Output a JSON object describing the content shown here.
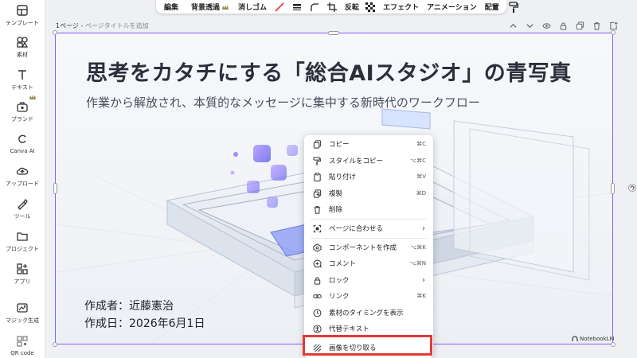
{
  "sidebar": {
    "items": [
      {
        "label": "テンプレート",
        "icon": "template-icon"
      },
      {
        "label": "素材",
        "icon": "elements-icon"
      },
      {
        "label": "テキスト",
        "icon": "text-icon"
      },
      {
        "label": "ブランド",
        "icon": "brand-icon"
      },
      {
        "label": "Canva AI",
        "icon": "canva-ai-icon"
      },
      {
        "label": "アップロード",
        "icon": "upload-icon"
      },
      {
        "label": "ツール",
        "icon": "tools-icon"
      },
      {
        "label": "プロジェクト",
        "icon": "folder-icon"
      },
      {
        "label": "アプリ",
        "icon": "apps-icon"
      },
      {
        "label": "マジック生成",
        "icon": "magic-icon"
      },
      {
        "label": "QR code",
        "icon": "qr-icon"
      }
    ]
  },
  "toolbar": {
    "edit": "編集",
    "bg_remove": "背景透過",
    "eraser": "消しゴム",
    "flip": "反転",
    "effects": "エフェクト",
    "animation": "アニメーション",
    "position": "配置"
  },
  "page": {
    "number": "1ページ",
    "separator": " - ",
    "title_placeholder": "ページタイトルを追加"
  },
  "slide": {
    "title": "思考をカタチにする「総合AIスタジオ」の青写真",
    "subtitle": "作業から解放され、本質的なメッセージに集中する新時代のワークフロー",
    "author": "作成者：近藤憲治",
    "date": "作成日：2026年6月1日",
    "watermark": "NotebookLM"
  },
  "context_menu": {
    "items": [
      {
        "label": "コピー",
        "shortcut": "⌘C",
        "icon": "copy-icon"
      },
      {
        "label": "スタイルをコピー",
        "shortcut": "⌥⌘C",
        "icon": "paint-roller-icon"
      },
      {
        "label": "貼り付け",
        "shortcut": "⌘V",
        "icon": "clipboard-icon"
      },
      {
        "label": "複製",
        "shortcut": "⌘D",
        "icon": "duplicate-icon"
      },
      {
        "label": "削除",
        "shortcut": "",
        "icon": "trash-icon"
      },
      {
        "label": "ページに合わせる",
        "shortcut": "",
        "icon": "fit-page-icon",
        "submenu": true
      },
      {
        "label": "コンポーネントを作成",
        "shortcut": "⌥⌘K",
        "icon": "component-icon"
      },
      {
        "label": "コメント",
        "shortcut": "⌥⌘N",
        "icon": "comment-icon"
      },
      {
        "label": "ロック",
        "shortcut": "",
        "icon": "lock-icon",
        "submenu": true
      },
      {
        "label": "リンク",
        "shortcut": "⌘K",
        "icon": "link-icon"
      },
      {
        "label": "素材のタイミングを表示",
        "shortcut": "",
        "icon": "clock-icon"
      },
      {
        "label": "代替テキスト",
        "shortcut": "",
        "icon": "accessibility-icon"
      },
      {
        "label": "画像を切り取る",
        "shortcut": "",
        "icon": "crop-image-icon",
        "highlighted": true
      }
    ]
  },
  "colors": {
    "selection": "#8b5cf6",
    "highlight": "#e53935",
    "eraser_slash": "#e53935"
  }
}
